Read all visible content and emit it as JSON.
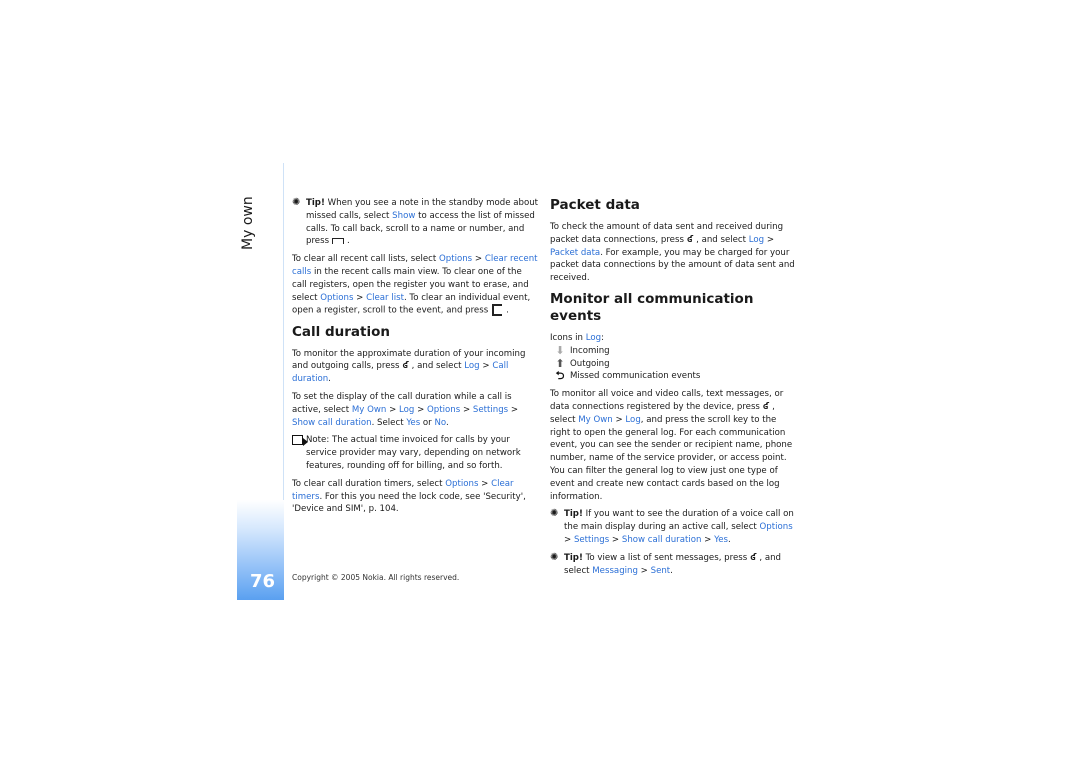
{
  "page": {
    "section_label": "My own",
    "page_number": "76",
    "footer": "Copyright © 2005 Nokia. All rights reserved.",
    "accent_color": "#2b6fd6"
  },
  "left": {
    "tip1": {
      "label": "Tip!",
      "t1": " When you see a note in the standby mode about missed calls, select ",
      "l1": "Show",
      "t2": " to access the list of missed calls. To call back, scroll to a name or number, and press",
      "t3": "."
    },
    "p1": {
      "t1": "To clear all recent call lists, select ",
      "l1": "Options",
      "t2": " > ",
      "l2": "Clear recent calls",
      "t3": " in the recent calls main view. To clear one of the call registers, open the register you want to erase, and select ",
      "l3": "Options",
      "t4": " > ",
      "l4": "Clear list",
      "t5": ". To clear an individual event, open a register, scroll to the event, and press",
      "t6": "."
    },
    "h_call_duration": "Call duration",
    "p2": {
      "t1": "To monitor the approximate duration of your incoming and outgoing calls, press",
      "t2": ", and select ",
      "l1": "Log",
      "t3": " > ",
      "l2": "Call duration",
      "t4": "."
    },
    "p3": {
      "t1": "To set the display of the call duration while a call is active, select ",
      "l1": "My Own",
      "t2": " > ",
      "l2": "Log",
      "t3": " > ",
      "l3": "Options",
      "t4": " > ",
      "l4": "Settings",
      "t5": " > ",
      "l5": "Show call duration",
      "t6": ". Select ",
      "l6": "Yes",
      "t7": " or ",
      "l7": "No",
      "t8": "."
    },
    "note": "Note: The actual time invoiced for calls by your service provider may vary, depending on network features, rounding off for billing, and so forth.",
    "p4": {
      "t1": "To clear call duration timers, select ",
      "l1": "Options",
      "t2": " > ",
      "l2": "Clear timers",
      "t3": ". For this you need the lock code, see 'Security', 'Device and SIM', p. 104."
    }
  },
  "right": {
    "h_packet": "Packet data",
    "p1": {
      "t1": "To check the amount of data sent and received during packet data connections, press",
      "t2": ", and select ",
      "l1": "Log",
      "t3": " > ",
      "l2": "Packet data",
      "t4": ". For example, you may be charged for your packet data connections by the amount of data sent and received."
    },
    "h_monitor": "Monitor all communication events",
    "icons_intro": {
      "t1": "Icons in ",
      "l1": "Log",
      "t2": ":"
    },
    "icons": [
      {
        "icon": "incoming-arrow-icon",
        "label": "Incoming"
      },
      {
        "icon": "outgoing-arrow-icon",
        "label": "Outgoing"
      },
      {
        "icon": "missed-event-icon",
        "label": "Missed communication events"
      }
    ],
    "p2": {
      "t1": "To monitor all voice and video calls, text messages, or data connections registered by the device, press",
      "t2": ", select ",
      "l1": "My Own",
      "t3": " > ",
      "l2": "Log",
      "t4": ", and press the scroll key to the right to open the general log. For each communication event, you can see the sender or recipient name, phone number, name of the service provider, or access point. You can filter the general log to view just one type of event and create new contact cards based on the log information."
    },
    "tip2": {
      "label": "Tip!",
      "t1": " If you want to see the duration of a voice call on the main display during an active call, select ",
      "l1": "Options",
      "t2": " > ",
      "l2": "Settings",
      "t3": " > ",
      "l3": "Show call duration",
      "t4": " > ",
      "l4": "Yes",
      "t5": "."
    },
    "tip3": {
      "label": "Tip!",
      "t1": " To view a list of sent messages, press",
      "t2": ", and select ",
      "l1": "Messaging",
      "t3": " > ",
      "l2": "Sent",
      "t4": "."
    }
  }
}
